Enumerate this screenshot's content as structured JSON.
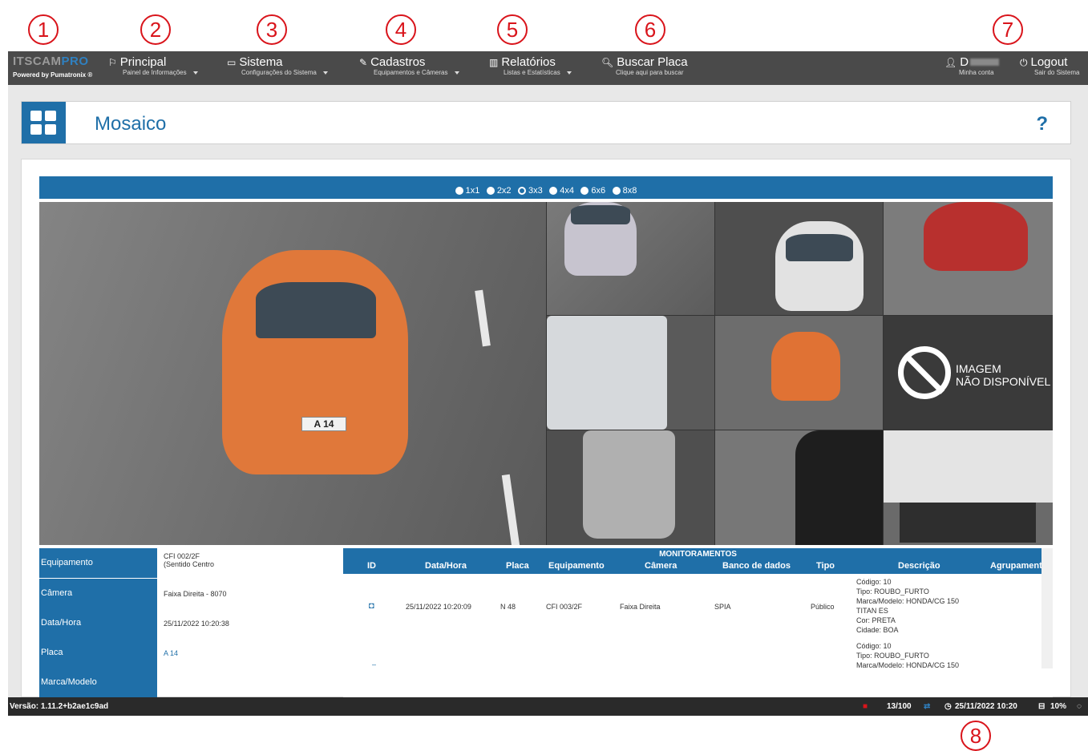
{
  "callouts": [
    "1",
    "2",
    "3",
    "4",
    "5",
    "6",
    "7",
    "8"
  ],
  "brand": {
    "name_part1": "ITSCAM",
    "name_part2": "PRO",
    "powered": "Powered by Pumatronix ®"
  },
  "nav": {
    "principal": {
      "label": "Principal",
      "sub": "Painel de Informações"
    },
    "sistema": {
      "label": "Sistema",
      "sub": "Configurações do Sistema"
    },
    "cadastros": {
      "label": "Cadastros",
      "sub": "Equipamentos e Câmeras"
    },
    "relatorios": {
      "label": "Relatórios",
      "sub": "Listas e Estatísticas"
    },
    "buscar": {
      "label": "Buscar Placa",
      "sub": "Clique aqui para buscar"
    },
    "user": {
      "label": "D",
      "sub": "Minha conta"
    },
    "logout": {
      "label": "Logout",
      "sub": "Sair do Sistema"
    }
  },
  "page": {
    "title": "Mosaico",
    "help": "?"
  },
  "grid_options": [
    "1x1",
    "2x2",
    "3x3",
    "4x4",
    "6x6",
    "8x8"
  ],
  "grid_selected": "3x3",
  "mosaic": {
    "main_plate": "A 14",
    "not_available": [
      "IMAGEM",
      "NÃO DISPONÍVEL"
    ]
  },
  "details": {
    "labels": [
      "Equipamento",
      "Câmera",
      "Data/Hora",
      "Placa",
      "Marca/Modelo"
    ],
    "equipamento": "CFI 002/2F",
    "equipamento_sub": "(Sentido Centro",
    "camera": "Faixa Direita - 8070",
    "datahora": "25/11/2022 10:20:38",
    "placa": "A 14",
    "marca": ""
  },
  "monitor": {
    "title": "MONITORAMENTOS",
    "columns": [
      "ID",
      "Data/Hora",
      "Placa",
      "Equipamento",
      "Câmera",
      "Banco de dados",
      "Tipo",
      "Descrição",
      "Agrupament"
    ],
    "row1": {
      "datahora": "25/11/2022 10:20:09",
      "placa": "N 48",
      "equipamento": "CFI 003/2F",
      "camera": "Faixa Direita",
      "banco": "SPIA",
      "tipo": "Público",
      "desc": [
        "Código: 10",
        "Tipo: ROUBO_FURTO",
        "Marca/Modelo: HONDA/CG 150",
        "TITAN ES",
        "Cor: PRETA",
        "Cidade: BOA"
      ]
    },
    "row2": {
      "desc": [
        "Código: 10",
        "Tipo: ROUBO_FURTO",
        "Marca/Modelo: HONDA/CG 150"
      ]
    }
  },
  "status": {
    "version": "Versão: 1.11.2+b2ae1c9ad",
    "count": "13/100",
    "clock": "25/11/2022 10:20",
    "disk": "10%"
  }
}
